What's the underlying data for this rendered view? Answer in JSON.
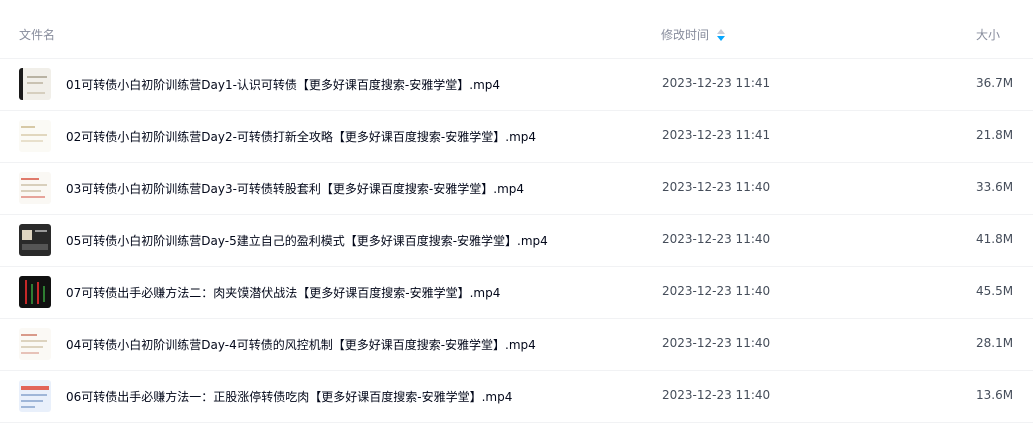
{
  "header": {
    "name_label": "文件名",
    "time_label": "修改时间",
    "size_label": "大小",
    "sort_icon": "sort-descending-icon",
    "sort_color": "#06a7ff"
  },
  "files": [
    {
      "name": "01可转债小白初阶训练营Day1-认识可转债【更多好课百度搜索-安雅学堂】.mp4",
      "time": "2023-12-23 11:41",
      "size": "36.7M",
      "thumb": "video-thumbnail"
    },
    {
      "name": "02可转债小白初阶训练营Day2-可转债打新全攻略【更多好课百度搜索-安雅学堂】.mp4",
      "time": "2023-12-23 11:41",
      "size": "21.8M",
      "thumb": "video-thumbnail"
    },
    {
      "name": "03可转债小白初阶训练营Day3-可转债转股套利【更多好课百度搜索-安雅学堂】.mp4",
      "time": "2023-12-23 11:40",
      "size": "33.6M",
      "thumb": "video-thumbnail"
    },
    {
      "name": "05可转债小白初阶训练营Day-5建立自己的盈利模式【更多好课百度搜索-安雅学堂】.mp4",
      "time": "2023-12-23 11:40",
      "size": "41.8M",
      "thumb": "video-thumbnail"
    },
    {
      "name": "07可转债出手必赚方法二：肉夹馍潜伏战法【更多好课百度搜索-安雅学堂】.mp4",
      "time": "2023-12-23 11:40",
      "size": "45.5M",
      "thumb": "video-thumbnail"
    },
    {
      "name": "04可转债小白初阶训练营Day-4可转债的风控机制【更多好课百度搜索-安雅学堂】.mp4",
      "time": "2023-12-23 11:40",
      "size": "28.1M",
      "thumb": "video-thumbnail"
    },
    {
      "name": "06可转债出手必赚方法一：正股涨停转债吃肉【更多好课百度搜索-安雅学堂】.mp4",
      "time": "2023-12-23 11:40",
      "size": "13.6M",
      "thumb": "video-thumbnail"
    }
  ]
}
